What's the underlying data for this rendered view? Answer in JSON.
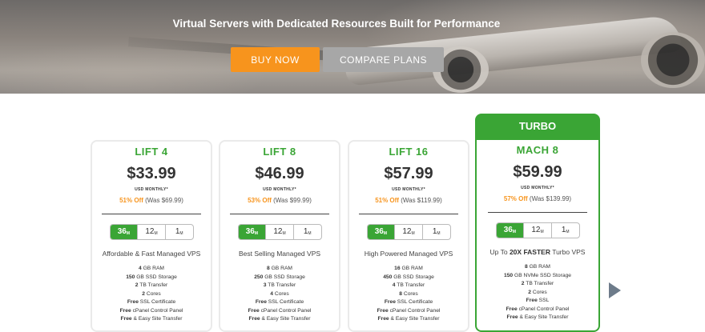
{
  "hero": {
    "title": "Virtual Servers with Dedicated Resources Built for Performance",
    "buy_label": "BUY NOW",
    "compare_label": "COMPARE PLANS"
  },
  "colors": {
    "brand_green": "#3aa535",
    "accent_orange": "#f7941d",
    "button_gray": "#a7a7a7"
  },
  "turbo_tab": "TURBO",
  "plans": [
    {
      "name": "LIFT 4",
      "price": "$33.99",
      "period": "USD MONTHLY*",
      "off": "51% Off",
      "was": "(Was $69.99)",
      "terms": [
        {
          "num": "36",
          "unit": "M"
        },
        {
          "num": "12",
          "unit": "M"
        },
        {
          "num": "1",
          "unit": "M"
        }
      ],
      "tagline_pre": "Affordable & Fast Managed VPS",
      "tagline_bold": "",
      "tagline_post": "",
      "features": [
        {
          "bold": "4",
          "text": " GB RAM"
        },
        {
          "bold": "150",
          "text": " GB SSD Storage"
        },
        {
          "bold": "2",
          "text": " TB Transfer"
        },
        {
          "bold": "2",
          "text": " Cores"
        },
        {
          "bold": "Free",
          "text": " SSL Certificate"
        },
        {
          "bold": "Free",
          "text": " cPanel Control Panel"
        },
        {
          "bold": "Free",
          "text": " & Easy Site Transfer"
        }
      ]
    },
    {
      "name": "LIFT 8",
      "price": "$46.99",
      "period": "USD MONTHLY*",
      "off": "53% Off",
      "was": "(Was $99.99)",
      "terms": [
        {
          "num": "36",
          "unit": "M"
        },
        {
          "num": "12",
          "unit": "M"
        },
        {
          "num": "1",
          "unit": "M"
        }
      ],
      "tagline_pre": "Best Selling Managed VPS",
      "tagline_bold": "",
      "tagline_post": "",
      "features": [
        {
          "bold": "8",
          "text": " GB RAM"
        },
        {
          "bold": "250",
          "text": " GB SSD Storage"
        },
        {
          "bold": "3",
          "text": " TB Transfer"
        },
        {
          "bold": "4",
          "text": " Cores"
        },
        {
          "bold": "Free",
          "text": " SSL Certificate"
        },
        {
          "bold": "Free",
          "text": " cPanel Control Panel"
        },
        {
          "bold": "Free",
          "text": " & Easy Site Transfer"
        }
      ]
    },
    {
      "name": "LIFT 16",
      "price": "$57.99",
      "period": "USD MONTHLY*",
      "off": "51% Off",
      "was": "(Was $119.99)",
      "terms": [
        {
          "num": "36",
          "unit": "M"
        },
        {
          "num": "12",
          "unit": "M"
        },
        {
          "num": "1",
          "unit": "M"
        }
      ],
      "tagline_pre": "High Powered Managed VPS",
      "tagline_bold": "",
      "tagline_post": "",
      "features": [
        {
          "bold": "16",
          "text": " GB RAM"
        },
        {
          "bold": "450",
          "text": " GB SSD Storage"
        },
        {
          "bold": "4",
          "text": " TB Transfer"
        },
        {
          "bold": "8",
          "text": " Cores"
        },
        {
          "bold": "Free",
          "text": " SSL Certificate"
        },
        {
          "bold": "Free",
          "text": " cPanel Control Panel"
        },
        {
          "bold": "Free",
          "text": " & Easy Site Transfer"
        }
      ]
    },
    {
      "name": "MACH 8",
      "price": "$59.99",
      "period": "USD MONTHLY*",
      "off": "57% Off",
      "was": "(Was $139.99)",
      "terms": [
        {
          "num": "36",
          "unit": "M"
        },
        {
          "num": "12",
          "unit": "M"
        },
        {
          "num": "1",
          "unit": "M"
        }
      ],
      "tagline_pre": "Up To ",
      "tagline_bold": "20X FASTER",
      "tagline_post": " Turbo VPS",
      "features": [
        {
          "bold": "8",
          "text": " GB RAM"
        },
        {
          "bold": "150",
          "text": " GB NVMe SSD Storage"
        },
        {
          "bold": "2",
          "text": " TB Transfer"
        },
        {
          "bold": "2",
          "text": " Cores"
        },
        {
          "bold": "Free",
          "text": " SSL"
        },
        {
          "bold": "Free",
          "text": " cPanel Control Panel"
        },
        {
          "bold": "Free",
          "text": " & Easy Site Transfer"
        }
      ]
    }
  ],
  "carousel": {
    "next_icon": "chevron-right-icon"
  }
}
